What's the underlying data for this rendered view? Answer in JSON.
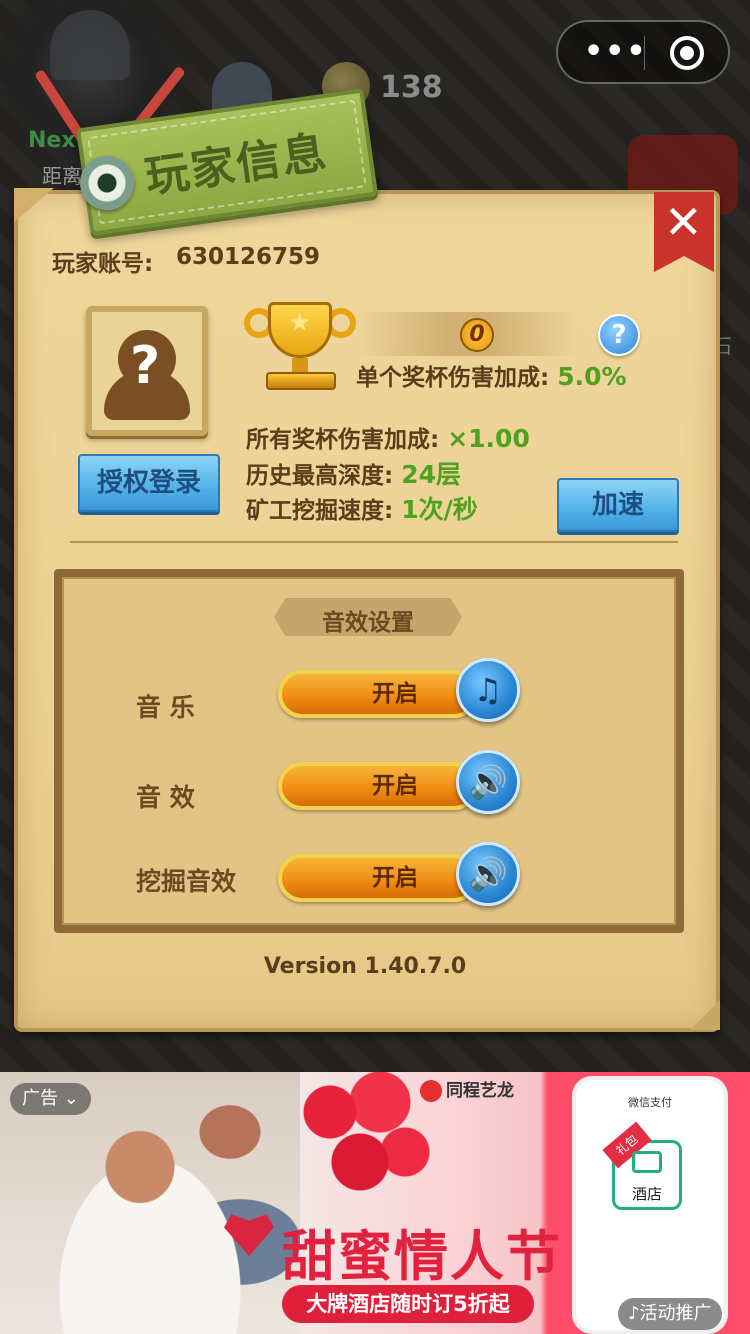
{
  "background": {
    "coin_count": "138",
    "next_label": "Next",
    "distance_label": "距离",
    "stone_label": "石"
  },
  "capsule": {
    "more_icon": "more-dots-icon",
    "close_icon": "target-circle-icon"
  },
  "panel": {
    "title": "玩家信息",
    "close_icon": "close-x-icon",
    "account_label": "玩家账号:",
    "account_value": "630126759",
    "login_button": "授权登录",
    "speed_button": "加速",
    "cup_count": "0",
    "single_cup_label": "单个奖杯伤害加成:",
    "single_cup_value": "5.0%",
    "all_cup_label": "所有奖杯伤害加成:",
    "all_cup_value": "×1.00",
    "depth_label": "历史最高深度:",
    "depth_value": "24层",
    "mining_label": "矿工挖掘速度:",
    "mining_value": "1次/秒",
    "help_glyph": "?"
  },
  "sound": {
    "title": "音效设置",
    "rows": [
      {
        "label": "音  乐",
        "toggle": "开启",
        "icon": "music-note-icon",
        "glyph": "♫"
      },
      {
        "label": "音  效",
        "toggle": "开启",
        "icon": "speaker-icon",
        "glyph": "🔊"
      },
      {
        "label": "挖掘音效",
        "toggle": "开启",
        "icon": "speaker-icon",
        "glyph": "🔊"
      }
    ]
  },
  "version": "Version 1.40.7.0",
  "ad": {
    "tag": "广告",
    "brand": "同程艺龙",
    "headline": "甜蜜情人节",
    "subline": "大牌酒店随时订5折起",
    "phone_title": "微信支付",
    "gift_badge": "礼包",
    "gift_label": "酒店",
    "promo": "♪活动推广"
  },
  "colors": {
    "panel_bg": "#efd69b",
    "value_green": "#4fa11f",
    "text_brown": "#5a3e1b",
    "button_blue": "#56b4ea",
    "toggle_orange": "#f08a10",
    "close_red": "#c9332b",
    "title_green": "#8ca843"
  }
}
